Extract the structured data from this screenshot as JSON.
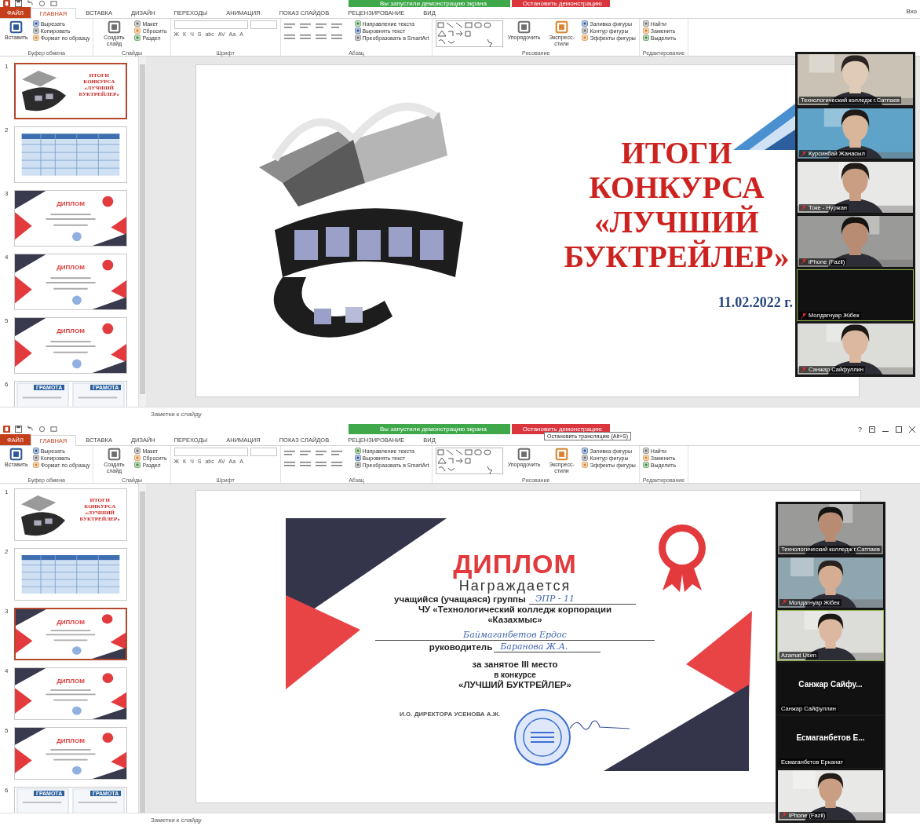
{
  "screens": [
    {
      "share_bar": {
        "status": "Вы запустили демонстрацию экрана",
        "stop": "Остановить демонстрацию"
      },
      "account": "Вхо",
      "tabs": [
        {
          "label": "ФАЙЛ",
          "kind": "file",
          "selected": false
        },
        {
          "label": "ГЛАВНАЯ",
          "kind": "tab",
          "selected": true
        },
        {
          "label": "ВСТАВКА",
          "kind": "tab",
          "selected": false
        },
        {
          "label": "ДИЗАЙН",
          "kind": "tab",
          "selected": false
        },
        {
          "label": "ПЕРЕХОДЫ",
          "kind": "tab",
          "selected": false
        },
        {
          "label": "АНИМАЦИЯ",
          "kind": "tab",
          "selected": false
        },
        {
          "label": "ПОКАЗ СЛАЙДОВ",
          "kind": "tab",
          "selected": false
        },
        {
          "label": "РЕЦЕНЗИРОВАНИЕ",
          "kind": "tab",
          "selected": false
        },
        {
          "label": "ВИД",
          "kind": "tab",
          "selected": false
        }
      ],
      "ribbon": [
        {
          "label": "Буфер обмена",
          "columns": [
            {
              "kind": "big",
              "label": "Вставить"
            },
            {
              "kind": "stack",
              "items": [
                "Вырезать",
                "Копировать",
                "Формат по образцу"
              ]
            }
          ]
        },
        {
          "label": "Слайды",
          "columns": [
            {
              "kind": "big",
              "label": "Создать слайд"
            },
            {
              "kind": "stack",
              "items": [
                "Макет",
                "Сбросить",
                "Раздел"
              ]
            }
          ]
        },
        {
          "label": "Шрифт",
          "columns": [
            {
              "kind": "font",
              "glyphs": [
                "Ж",
                "К",
                "Ч",
                "S",
                "abc",
                "AV",
                "Aa",
                "A"
              ]
            }
          ]
        },
        {
          "label": "Абзац",
          "columns": [
            {
              "kind": "paragraph"
            },
            {
              "kind": "stack",
              "items": [
                "Направление текста",
                "Выровнять текст",
                "Преобразовать в SmartArt"
              ]
            }
          ]
        },
        {
          "label": "Рисование",
          "columns": [
            {
              "kind": "shapes"
            },
            {
              "kind": "big",
              "label": "Упорядочить"
            },
            {
              "kind": "big",
              "label": "Экспресс-стили"
            },
            {
              "kind": "stack",
              "items": [
                "Заливка фигуры",
                "Контур фигуры",
                "Эффекты фигуры"
              ]
            }
          ]
        },
        {
          "label": "Редактирование",
          "columns": [
            {
              "kind": "stack",
              "items": [
                "Найти",
                "Заменить",
                "Выделить"
              ]
            }
          ]
        }
      ],
      "thumbnails": [
        {
          "number": "1",
          "kind": "title",
          "selected": true,
          "lines": [
            "ИТОГИ",
            "КОНКУРСА",
            "«ЛУЧШИЙ",
            "БУКТРЕЙЛЕР»"
          ]
        },
        {
          "number": "2",
          "kind": "table",
          "selected": false
        },
        {
          "number": "3",
          "kind": "diploma",
          "selected": false,
          "heading": "ДИПЛОМ"
        },
        {
          "number": "4",
          "kind": "diploma",
          "selected": false,
          "heading": "ДИПЛОМ"
        },
        {
          "number": "5",
          "kind": "diploma",
          "selected": false,
          "heading": "ДИПЛОМ"
        },
        {
          "number": "6",
          "kind": "gramota",
          "selected": false,
          "labels": [
            "ГРАМОТА",
            "ГРАМОТА"
          ]
        }
      ],
      "slide": {
        "kind": "title",
        "lines": [
          "ИТОГИ",
          "КОНКУРСА",
          "«ЛУЧШИЙ",
          "БУКТРЕЙЛЕР»"
        ],
        "date": "11.02.2022 г."
      },
      "participants": [
        {
          "kind": "video",
          "name": "Технологический колледж г.Сатпаев",
          "muted": false,
          "highlighted": false
        },
        {
          "kind": "video",
          "name": "Курсинбай Жанасыл",
          "muted": true,
          "highlighted": false
        },
        {
          "kind": "video",
          "name": "Токе - Нуржан",
          "muted": true,
          "highlighted": false
        },
        {
          "kind": "video",
          "name": "iPhone (Fazil)",
          "muted": true,
          "highlighted": false
        },
        {
          "kind": "blank",
          "name": "Молдагнуар Жібек",
          "muted": true,
          "highlighted": true
        },
        {
          "kind": "video",
          "name": "Санжар Сайфуллин",
          "muted": true,
          "highlighted": false
        }
      ],
      "notes": "Заметки к слайду"
    },
    {
      "share_bar": {
        "status": "Вы запустили демонстрацию экрана",
        "stop": "Остановить демонстрацию"
      },
      "tooltip": "Остановить трансляцию (Alt+S)",
      "help": "?",
      "tabs": [
        {
          "label": "ФАЙЛ",
          "kind": "file",
          "selected": false
        },
        {
          "label": "ГЛАВНАЯ",
          "kind": "tab",
          "selected": true
        },
        {
          "label": "ВСТАВКА",
          "kind": "tab",
          "selected": false
        },
        {
          "label": "ДИЗАЙН",
          "kind": "tab",
          "selected": false
        },
        {
          "label": "ПЕРЕХОДЫ",
          "kind": "tab",
          "selected": false
        },
        {
          "label": "АНИМАЦИЯ",
          "kind": "tab",
          "selected": false
        },
        {
          "label": "ПОКАЗ СЛАЙДОВ",
          "kind": "tab",
          "selected": false
        },
        {
          "label": "РЕЦЕНЗИРОВАНИЕ",
          "kind": "tab",
          "selected": false
        },
        {
          "label": "ВИД",
          "kind": "tab",
          "selected": false
        }
      ],
      "ribbon": [
        {
          "label": "Буфер обмена",
          "columns": [
            {
              "kind": "big",
              "label": "Вставить"
            },
            {
              "kind": "stack",
              "items": [
                "Вырезать",
                "Копировать",
                "Формат по образцу"
              ]
            }
          ]
        },
        {
          "label": "Слайды",
          "columns": [
            {
              "kind": "big",
              "label": "Создать слайд"
            },
            {
              "kind": "stack",
              "items": [
                "Макет",
                "Сбросить",
                "Раздел"
              ]
            }
          ]
        },
        {
          "label": "Шрифт",
          "columns": [
            {
              "kind": "font",
              "glyphs": [
                "Ж",
                "К",
                "Ч",
                "S",
                "abc",
                "AV",
                "Aa",
                "A"
              ]
            }
          ]
        },
        {
          "label": "Абзац",
          "columns": [
            {
              "kind": "paragraph"
            },
            {
              "kind": "stack",
              "items": [
                "Направление текста",
                "Выровнять текст",
                "Преобразовать в SmartArt"
              ]
            }
          ]
        },
        {
          "label": "Рисование",
          "columns": [
            {
              "kind": "shapes"
            },
            {
              "kind": "big",
              "label": "Упорядочить"
            },
            {
              "kind": "big",
              "label": "Экспресс-стили"
            },
            {
              "kind": "stack",
              "items": [
                "Заливка фигуры",
                "Контур фигуры",
                "Эффекты фигуры"
              ]
            }
          ]
        },
        {
          "label": "Редактирование",
          "columns": [
            {
              "kind": "stack",
              "items": [
                "Найти",
                "Заменить",
                "Выделить"
              ]
            }
          ]
        }
      ],
      "thumbnails": [
        {
          "number": "1",
          "kind": "title",
          "selected": false,
          "lines": [
            "ИТОГИ",
            "КОНКУРСА",
            "«ЛУЧШИЙ",
            "БУКТРЕЙЛЕР»"
          ]
        },
        {
          "number": "2",
          "kind": "table",
          "selected": false
        },
        {
          "number": "3",
          "kind": "diploma",
          "selected": true,
          "heading": "ДИПЛОМ"
        },
        {
          "number": "4",
          "kind": "diploma",
          "selected": false,
          "heading": "ДИПЛОМ"
        },
        {
          "number": "5",
          "kind": "diploma",
          "selected": false,
          "heading": "ДИПЛОМ"
        },
        {
          "number": "6",
          "kind": "gramota",
          "selected": false,
          "labels": [
            "ГРАМОТА",
            "ГРАМОТА"
          ]
        }
      ],
      "slide": {
        "kind": "diploma",
        "heading": "ДИПЛОМ",
        "subtitle": "Награждается",
        "group_label": "учащийся (учащаяся) группы",
        "group_value": "ЭПР - 11",
        "org": [
          "ЧУ «Технологический колледж корпорации",
          "«Казахмыс»"
        ],
        "student": "Баймаганбетов   Ердос",
        "supervisor_label": "руководитель",
        "supervisor": "Баранова Ж.А.",
        "place": "за занятое III место",
        "contest_label": "в конкурсе",
        "contest": "«ЛУЧШИЙ БУКТРЕЙЛЕР»",
        "director": "И.О. ДИРЕКТОРА УСЕНОВА А.Ж."
      },
      "participants": [
        {
          "kind": "video",
          "name": "Технологический колледж г.Сатпаев",
          "muted": false,
          "highlighted": false
        },
        {
          "kind": "video",
          "name": "Молдагнуар Жібек",
          "muted": true,
          "highlighted": false
        },
        {
          "kind": "video",
          "name": "Azamat Usen",
          "muted": false,
          "highlighted": true
        },
        {
          "kind": "name",
          "display": "Санжар  Сайфу...",
          "name": "Санжар Сайфуллин",
          "muted": false,
          "highlighted": false
        },
        {
          "kind": "name",
          "display": "Есмаганбетов  Е...",
          "name": "Есмаганбетов Ерканат",
          "muted": false,
          "highlighted": false
        },
        {
          "kind": "video",
          "name": "iPhone (Fazil)",
          "muted": true,
          "highlighted": false
        }
      ],
      "notes": "Заметки к слайду"
    }
  ]
}
